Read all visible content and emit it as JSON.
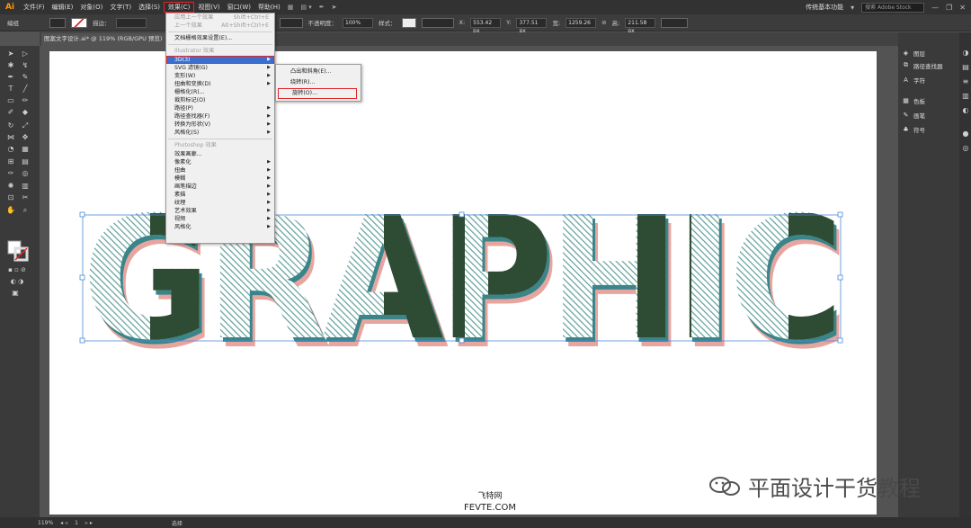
{
  "menubar": {
    "logo": "Ai",
    "items": [
      "文件(F)",
      "编辑(E)",
      "对象(O)",
      "文字(T)",
      "选择(S)",
      "效果(C)",
      "视图(V)",
      "窗口(W)",
      "帮助(H)"
    ],
    "workspace": "传统基本功能",
    "search_placeholder": "搜索 Adobe Stock"
  },
  "optbar": {
    "label": "编组",
    "stroke_label": "描边：",
    "opacity_label": "不透明度：",
    "opacity": "100%",
    "style_label": "样式：",
    "x": "553.42 px",
    "y": "377.51 px",
    "w": "1259.26",
    "h": "211.58 px"
  },
  "document": {
    "tab_title": "图案文字设计.ai* @ 119% (RGB/GPU 预览)"
  },
  "effect_menu": {
    "apply_last": "应用上一个效果",
    "apply_last_sc": "Shift+Ctrl+E",
    "last": "上一个效果",
    "last_sc": "Alt+Shift+Ctrl+E",
    "raster": "文档栅格效果设置(E)...",
    "illustrator_header": "Illustrator 效果",
    "illustrator_items": [
      "3D(3)",
      "SVG 滤镜(G)",
      "变形(W)",
      "扭曲和变换(D)",
      "栅格化(R)...",
      "裁剪标记(O)",
      "路径(P)",
      "路径查找器(F)",
      "转换为形状(V)",
      "风格化(S)"
    ],
    "photoshop_header": "Photoshop 效果",
    "photoshop_items": [
      "效果画廊...",
      "像素化",
      "扭曲",
      "模糊",
      "画笔描边",
      "素描",
      "纹理",
      "艺术效果",
      "视频",
      "风格化"
    ]
  },
  "submenu_3d": {
    "items": [
      "凸出和斜角(E)...",
      "绕转(R)...",
      "旋转(O)..."
    ]
  },
  "panels": {
    "items": [
      "图层",
      "路径查找器",
      "字符",
      "色板",
      "画笔",
      "符号"
    ]
  },
  "statusbar": {
    "zoom": "119%",
    "page": "1",
    "tool": "选择"
  },
  "artwork": {
    "word": "GRAPHIC",
    "colors": {
      "dark": "#2e4b33",
      "pink": "#e7a5a0",
      "teal": "#3a8589",
      "stripe": "#5f9f9a"
    }
  },
  "watermark": {
    "text": "平面设计干货教程",
    "site1": "飞特网",
    "site2": "FEVTE.COM"
  }
}
